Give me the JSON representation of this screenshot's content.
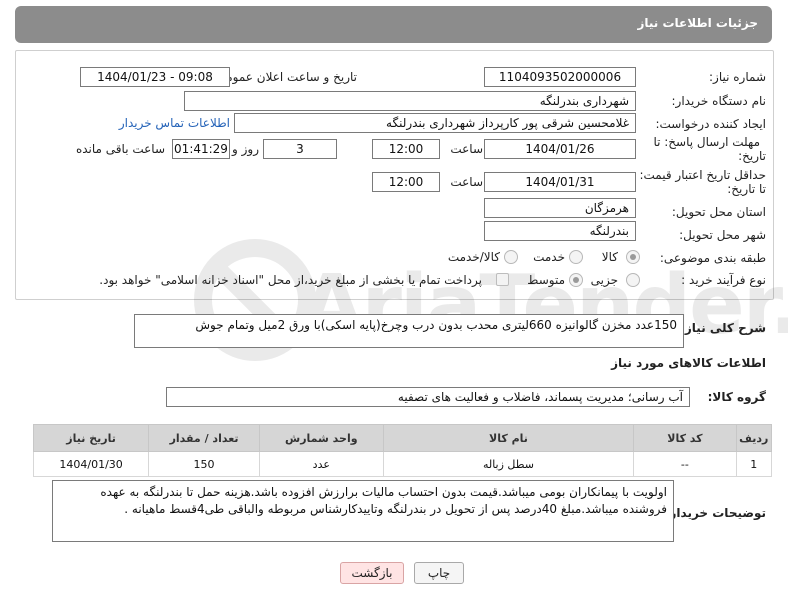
{
  "header": {
    "title": "جزئیات اطلاعات نیاز"
  },
  "fields": {
    "need_number": {
      "label": "شماره نیاز:",
      "value": "1104093502000006"
    },
    "announce_datetime": {
      "label": "تاریخ و ساعت اعلان عمومی:",
      "value": "1404/01/23 - 09:08"
    },
    "buyer_org": {
      "label": "نام دستگاه خریدار:",
      "value": "شهرداری بندرلنگه"
    },
    "requester": {
      "label": "ایجاد کننده درخواست:",
      "value": "غلامحسین شرقی پور کارپرداز شهرداری بندرلنگه",
      "contact_link": "اطلاعات تماس خریدار"
    },
    "reply_deadline": {
      "label_line1": "مهلت ارسال پاسخ: تا",
      "label_line2": "تاریخ:",
      "date": "1404/01/26",
      "time_label": "ساعت",
      "time": "12:00",
      "days": "3",
      "days_label": "روز و",
      "remaining": "01:41:29",
      "remaining_label": "ساعت باقی مانده"
    },
    "price_validity": {
      "label_line1": "حداقل تاریخ اعتبار قیمت:",
      "label_line2": "تا تاریخ:",
      "date": "1404/01/31",
      "time_label": "ساعت",
      "time": "12:00"
    },
    "province": {
      "label": "استان محل تحویل:",
      "value": "هرمزگان"
    },
    "city": {
      "label": "شهر محل تحویل:",
      "value": "بندرلنگه"
    },
    "category": {
      "label": "طبقه بندی موضوعی:",
      "options": [
        "کالا",
        "خدمت",
        "کالا/خدمت"
      ],
      "selected": "کالا"
    },
    "process_type": {
      "label": "نوع فرآیند خرید :",
      "options": [
        "جزیی",
        "متوسط"
      ],
      "selected": "متوسط",
      "payment_note": "پرداخت تمام یا بخشی از مبلغ خرید،از محل \"اسناد خزانه اسلامی\" خواهد بود."
    }
  },
  "general_description": {
    "label": "شرح کلی نیاز:",
    "value": "150عدد مخزن  گالوانیزه 660لیتری محدب بدون درب وچرخ(پایه اسکی)با ورق 2میل وتمام جوش"
  },
  "goods_section": {
    "title": "اطلاعات کالاهای مورد نیاز"
  },
  "goods_group": {
    "label": "گروه کالا:",
    "value": "آب رسانی؛ مدیریت پسماند، فاضلاب و فعالیت های تصفیه"
  },
  "table": {
    "headers": [
      "ردیف",
      "کد کالا",
      "نام کالا",
      "واحد شمارش",
      "تعداد / مقدار",
      "تاریخ نیاز"
    ],
    "rows": [
      [
        "1",
        "--",
        "سطل زباله",
        "عدد",
        "150",
        "1404/01/30"
      ]
    ]
  },
  "buyer_notes": {
    "label": "توضیحات خریدار:",
    "value": "اولویت با پیمانکاران بومی میباشد.قیمت بدون احتساب مالیات برارزش افزوده باشد.هزینه حمل تا بندرلنگه به عهده فروشنده میباشد.مبلغ 40درصد پس از تحویل در بندرلنگه وتاییدکارشناس مربوطه والباقی طی4قسط ماهیانه ."
  },
  "buttons": {
    "print": "چاپ",
    "back": "بازگشت"
  },
  "colors": {
    "header_bg": "#8c8c8c",
    "table_header_bg": "#d6d6d6",
    "link": "#2563b8",
    "back_button_bg": "#ffe4e4"
  }
}
